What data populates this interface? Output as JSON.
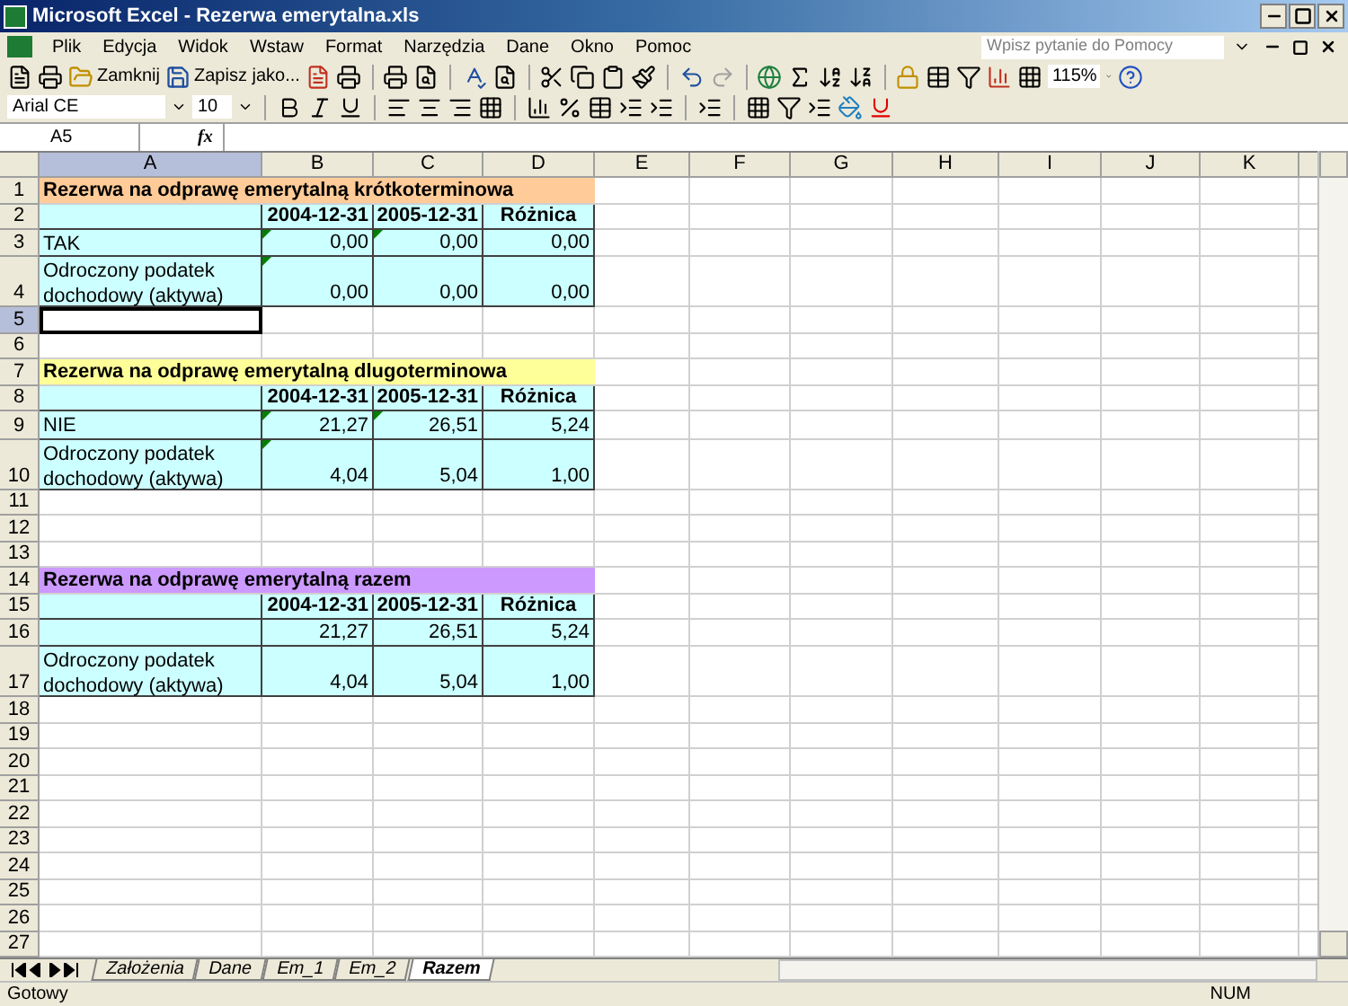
{
  "window": {
    "title": "Microsoft Excel - Rezerwa emerytalna.xls"
  },
  "menu": [
    "Plik",
    "Edycja",
    "Widok",
    "Wstaw",
    "Format",
    "Narzędzia",
    "Dane",
    "Okno",
    "Pomoc"
  ],
  "help": {
    "placeholder": "Wpisz pytanie do Pomocy"
  },
  "toolbar": {
    "close_label": "Zamknij",
    "save_as_label": "Zapisz jako...",
    "zoom": "115%"
  },
  "format_bar": {
    "font": "Arial CE",
    "size": "10"
  },
  "formula_bar": {
    "name_box": "A5",
    "fx": "fx"
  },
  "columns": [
    {
      "label": "A",
      "selected": true
    },
    {
      "label": "B",
      "selected": false
    },
    {
      "label": "C",
      "selected": false
    },
    {
      "label": "D",
      "selected": false
    },
    {
      "label": "E",
      "selected": false
    },
    {
      "label": "F",
      "selected": false
    },
    {
      "label": "G",
      "selected": false
    },
    {
      "label": "H",
      "selected": false
    },
    {
      "label": "I",
      "selected": false
    },
    {
      "label": "J",
      "selected": false
    },
    {
      "label": "K",
      "selected": false
    }
  ],
  "rows": [
    {
      "label": "1",
      "selected": false,
      "kind": "title",
      "text": "Rezerwa na odprawę emerytalną krótkoterminowa",
      "color": "#ffcc99"
    },
    {
      "label": "2",
      "selected": false,
      "kind": "header",
      "cells": [
        "2004-12-31",
        "2005-12-31",
        "Różnica"
      ]
    },
    {
      "label": "3",
      "selected": false,
      "kind": "data",
      "text": "TAK",
      "values": [
        {
          "text": "0,00",
          "flag": true
        },
        {
          "text": "0,00",
          "flag": true
        },
        {
          "text": "0,00",
          "flag": false
        }
      ]
    },
    {
      "label": "4",
      "selected": false,
      "kind": "data",
      "text": "Odroczony podatek dochodowy (aktywa)",
      "values": [
        {
          "text": "0,00",
          "flag": true
        },
        {
          "text": "0,00",
          "flag": false
        },
        {
          "text": "0,00",
          "flag": false
        }
      ]
    },
    {
      "label": "5",
      "selected": true,
      "kind": "blank"
    },
    {
      "label": "6",
      "selected": false,
      "kind": "blank"
    },
    {
      "label": "7",
      "selected": false,
      "kind": "title",
      "text": "Rezerwa na odprawę emerytalną dlugoterminowa",
      "color": "#ffff99"
    },
    {
      "label": "8",
      "selected": false,
      "kind": "header",
      "cells": [
        "2004-12-31",
        "2005-12-31",
        "Różnica"
      ]
    },
    {
      "label": "9",
      "selected": false,
      "kind": "data",
      "text": "NIE",
      "values": [
        {
          "text": "21,27",
          "flag": true
        },
        {
          "text": "26,51",
          "flag": true
        },
        {
          "text": "5,24",
          "flag": false
        }
      ]
    },
    {
      "label": "10",
      "selected": false,
      "kind": "data",
      "text": "Odroczony podatek dochodowy (aktywa)",
      "values": [
        {
          "text": "4,04",
          "flag": true
        },
        {
          "text": "5,04",
          "flag": false
        },
        {
          "text": "1,00",
          "flag": false
        }
      ]
    },
    {
      "label": "11",
      "selected": false,
      "kind": "blank"
    },
    {
      "label": "12",
      "selected": false,
      "kind": "blank"
    },
    {
      "label": "13",
      "selected": false,
      "kind": "blank"
    },
    {
      "label": "14",
      "selected": false,
      "kind": "title",
      "text": "Rezerwa na odprawę emerytalną razem",
      "color": "#cc99ff"
    },
    {
      "label": "15",
      "selected": false,
      "kind": "header",
      "cells": [
        "2004-12-31",
        "2005-12-31",
        "Różnica"
      ]
    },
    {
      "label": "16",
      "selected": false,
      "kind": "data",
      "text": "",
      "values": [
        {
          "text": "21,27",
          "flag": false
        },
        {
          "text": "26,51",
          "flag": false
        },
        {
          "text": "5,24",
          "flag": false
        }
      ]
    },
    {
      "label": "17",
      "selected": false,
      "kind": "data",
      "text": "Odroczony podatek dochodowy (aktywa)",
      "values": [
        {
          "text": "4,04",
          "flag": false
        },
        {
          "text": "5,04",
          "flag": false
        },
        {
          "text": "1,00",
          "flag": false
        }
      ]
    },
    {
      "label": "18",
      "selected": false,
      "kind": "blank"
    },
    {
      "label": "19",
      "selected": false,
      "kind": "blank"
    },
    {
      "label": "20",
      "selected": false,
      "kind": "blank"
    },
    {
      "label": "21",
      "selected": false,
      "kind": "blank"
    },
    {
      "label": "22",
      "selected": false,
      "kind": "blank"
    },
    {
      "label": "23",
      "selected": false,
      "kind": "blank"
    },
    {
      "label": "24",
      "selected": false,
      "kind": "blank"
    },
    {
      "label": "25",
      "selected": false,
      "kind": "blank"
    },
    {
      "label": "26",
      "selected": false,
      "kind": "blank"
    },
    {
      "label": "27",
      "selected": false,
      "kind": "blank"
    }
  ],
  "sheets": [
    {
      "label": "Założenia",
      "selected": false
    },
    {
      "label": "Dane",
      "selected": false
    },
    {
      "label": "Em_1",
      "selected": false
    },
    {
      "label": "Em_2",
      "selected": false
    },
    {
      "label": "Razem",
      "selected": true
    }
  ],
  "status_bar": {
    "text": "Gotowy",
    "num": "NUM"
  }
}
